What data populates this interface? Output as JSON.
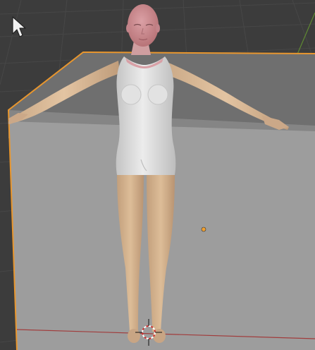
{
  "viewport": {
    "background": "#3c3c3c",
    "grid_color": "#474747",
    "selection_outline": "#e8962e",
    "x_axis_color": "#a13c3c",
    "y_axis_color": "#6f9a3a"
  },
  "icons": {
    "cursor": "mouse-pointer-icon",
    "origin": "object-origin-icon",
    "3d_cursor": "3d-cursor-icon"
  },
  "scene": {
    "objects": [
      {
        "type": "mesh-plane",
        "selected": true
      },
      {
        "type": "human-figure",
        "selected": false
      }
    ]
  }
}
